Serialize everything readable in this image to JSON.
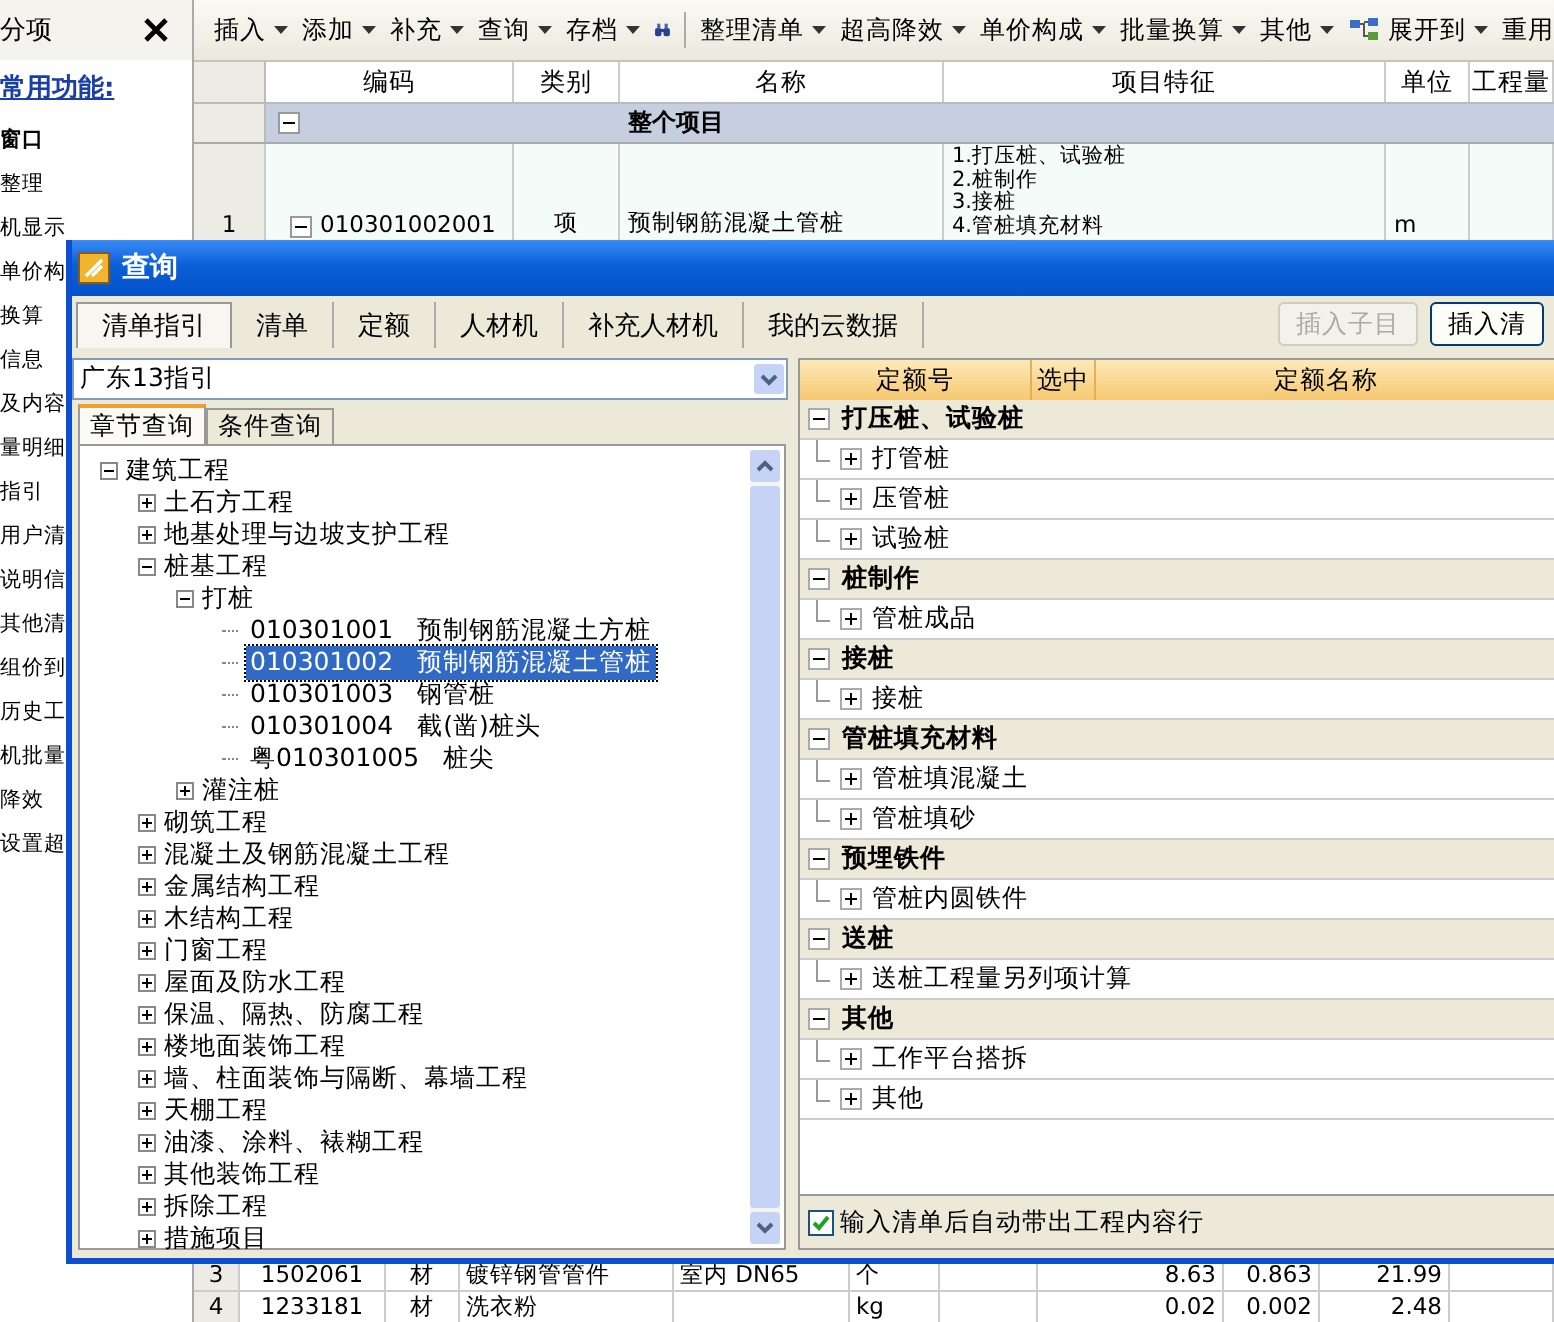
{
  "left_panel": {
    "title": "分项",
    "section_title": "常用功能:",
    "items": [
      {
        "kind": "heading",
        "label": "窗口"
      },
      {
        "kind": "item",
        "label": "整理"
      },
      {
        "kind": "item",
        "label": "机显示"
      },
      {
        "kind": "item",
        "label": "单价构"
      },
      {
        "kind": "item",
        "label": "换算"
      },
      {
        "kind": "item",
        "label": "信息"
      },
      {
        "kind": "item",
        "label": "及内容"
      },
      {
        "kind": "item",
        "label": "量明细"
      },
      {
        "kind": "item",
        "label": "指引"
      },
      {
        "kind": "item",
        "label": "用户清"
      },
      {
        "kind": "item",
        "label": "说明信"
      },
      {
        "kind": "item",
        "label": "其他清"
      },
      {
        "kind": "item",
        "label": "组价到"
      },
      {
        "kind": "item",
        "label": "历史工"
      },
      {
        "kind": "item",
        "label": "机批量"
      },
      {
        "kind": "item",
        "label": "降效"
      },
      {
        "kind": "item",
        "label": "设置超"
      }
    ]
  },
  "toolbar": [
    {
      "kind": "menu",
      "label": "插入"
    },
    {
      "kind": "menu",
      "label": "添加"
    },
    {
      "kind": "menu",
      "label": "补充"
    },
    {
      "kind": "menu",
      "label": "查询"
    },
    {
      "kind": "menu",
      "label": "存档"
    },
    {
      "kind": "find"
    },
    {
      "kind": "separator"
    },
    {
      "kind": "menu",
      "label": "整理清单"
    },
    {
      "kind": "menu",
      "label": "超高降效"
    },
    {
      "kind": "menu",
      "label": "单价构成"
    },
    {
      "kind": "menu",
      "label": "批量换算"
    },
    {
      "kind": "menu",
      "label": "其他"
    },
    {
      "kind": "tree-menu",
      "label": "展开到"
    },
    {
      "kind": "plain",
      "label": "重用"
    }
  ],
  "table": {
    "columns": [
      "编码",
      "类别",
      "名称",
      "项目特征",
      "单位",
      "工程量"
    ],
    "group_row": {
      "label": "整个项目",
      "expanded": true
    },
    "rows": [
      {
        "number": "1",
        "code": "010301002001",
        "type": "项",
        "name": "预制钢筋混凝土管桩",
        "features": [
          "1.打压桩、试验桩",
          "2.桩制作",
          "3.接桩",
          "4.管桩填充材料"
        ],
        "unit": "m",
        "expanded": true
      }
    ],
    "detail_rows": [
      {
        "number": "3",
        "code": "1502061",
        "type": "材",
        "name": "镀锌钢管管件",
        "spec": "室内 DN65",
        "unit": "个",
        "column_8": "8.63",
        "column_9": "0.863",
        "column_10": "21.99"
      },
      {
        "number": "4",
        "code": "1233181",
        "type": "材",
        "name": "洗衣粉",
        "unit": "kg",
        "column_8": "0.02",
        "column_9": "0.002",
        "column_10": "2.48"
      }
    ]
  },
  "dialog": {
    "title": "查询",
    "tabs": [
      {
        "label": "清单指引",
        "selected": true
      },
      {
        "label": "清单",
        "selected": false
      },
      {
        "label": "定额",
        "selected": false
      },
      {
        "label": "人材机",
        "selected": false
      },
      {
        "label": "补充人材机",
        "selected": false
      },
      {
        "label": "我的云数据",
        "selected": false
      }
    ],
    "buttons": [
      {
        "label": "插入子目",
        "disabled": true
      },
      {
        "label": "插入清",
        "disabled": false
      }
    ],
    "library": "广东13指引",
    "subtabs": [
      {
        "label": "章节查询",
        "selected": true
      },
      {
        "label": "条件查询",
        "selected": false
      }
    ],
    "tree": [
      {
        "kind": "folder",
        "label": "建筑工程",
        "expanded": true,
        "children": [
          {
            "kind": "folder",
            "label": "土石方工程",
            "expanded": false
          },
          {
            "kind": "folder",
            "label": "地基处理与边坡支护工程",
            "expanded": false
          },
          {
            "kind": "folder",
            "label": "桩基工程",
            "expanded": true,
            "children": [
              {
                "kind": "folder",
                "label": "打桩",
                "expanded": true,
                "children": [
                  {
                    "kind": "entry",
                    "code": "010301001",
                    "label": "预制钢筋混凝土方桩",
                    "selected": false
                  },
                  {
                    "kind": "entry",
                    "code": "010301002",
                    "label": "预制钢筋混凝土管桩",
                    "selected": true
                  },
                  {
                    "kind": "entry",
                    "code": "010301003",
                    "label": "钢管桩",
                    "selected": false
                  },
                  {
                    "kind": "entry",
                    "code": "010301004",
                    "label": "截(凿)桩头",
                    "selected": false
                  },
                  {
                    "kind": "entry",
                    "code": "粤010301005",
                    "label": "桩尖",
                    "selected": false
                  }
                ]
              },
              {
                "kind": "folder",
                "label": "灌注桩",
                "expanded": false
              }
            ]
          },
          {
            "kind": "folder",
            "label": "砌筑工程",
            "expanded": false
          },
          {
            "kind": "folder",
            "label": "混凝土及钢筋混凝土工程",
            "expanded": false
          },
          {
            "kind": "folder",
            "label": "金属结构工程",
            "expanded": false
          },
          {
            "kind": "folder",
            "label": "木结构工程",
            "expanded": false
          },
          {
            "kind": "folder",
            "label": "门窗工程",
            "expanded": false
          },
          {
            "kind": "folder",
            "label": "屋面及防水工程",
            "expanded": false
          },
          {
            "kind": "folder",
            "label": "保温、隔热、防腐工程",
            "expanded": false
          },
          {
            "kind": "folder",
            "label": "楼地面装饰工程",
            "expanded": false
          },
          {
            "kind": "folder",
            "label": "墙、柱面装饰与隔断、幕墙工程",
            "expanded": false
          },
          {
            "kind": "folder",
            "label": "天棚工程",
            "expanded": false
          },
          {
            "kind": "folder",
            "label": "油漆、涂料、裱糊工程",
            "expanded": false
          },
          {
            "kind": "folder",
            "label": "其他装饰工程",
            "expanded": false
          },
          {
            "kind": "folder",
            "label": "拆除工程",
            "expanded": false
          },
          {
            "kind": "folder",
            "label": "措施项目",
            "expanded": false
          }
        ]
      }
    ],
    "quota_table": {
      "columns": [
        "定额号",
        "选中",
        "定额名称"
      ],
      "groups": [
        {
          "label": "打压桩、试验桩",
          "expanded": true,
          "items": [
            {
              "label": "打管桩",
              "expanded": false
            },
            {
              "label": "压管桩",
              "expanded": false
            },
            {
              "label": "试验桩",
              "expanded": false
            }
          ]
        },
        {
          "label": "桩制作",
          "expanded": true,
          "items": [
            {
              "label": "管桩成品",
              "expanded": false
            }
          ]
        },
        {
          "label": "接桩",
          "expanded": true,
          "items": [
            {
              "label": "接桩",
              "expanded": false
            }
          ]
        },
        {
          "label": "管桩填充材料",
          "expanded": true,
          "items": [
            {
              "label": "管桩填混凝土",
              "expanded": false
            },
            {
              "label": "管桩填砂",
              "expanded": false
            }
          ]
        },
        {
          "label": "预埋铁件",
          "expanded": true,
          "items": [
            {
              "label": "管桩内圆铁件",
              "expanded": false
            }
          ]
        },
        {
          "label": "送桩",
          "expanded": true,
          "items": [
            {
              "label": "送桩工程量另列项计算",
              "expanded": false
            }
          ]
        },
        {
          "label": "其他",
          "expanded": true,
          "items": [
            {
              "label": "工作平台搭拆",
              "expanded": false
            },
            {
              "label": "其他",
              "expanded": false
            }
          ]
        }
      ]
    },
    "auto_fill": {
      "label": "输入清单后自动带出工程内容行",
      "checked": true
    }
  }
}
